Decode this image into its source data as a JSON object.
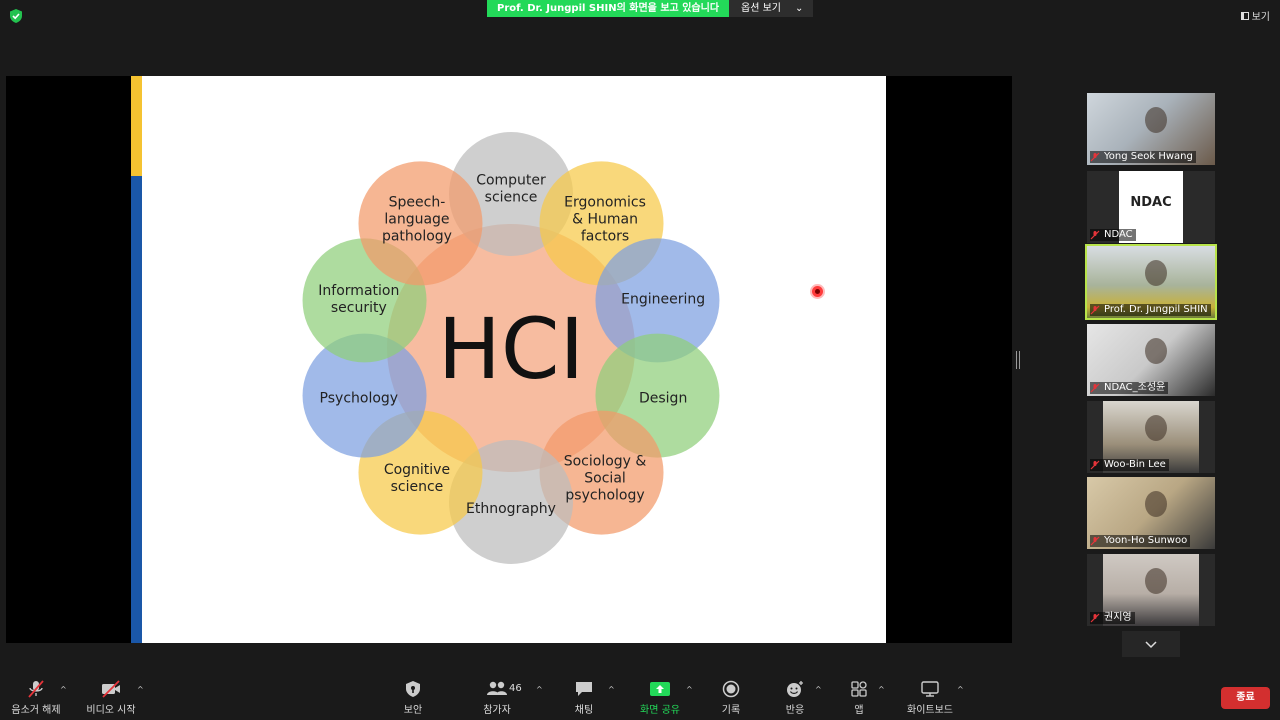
{
  "top": {
    "share_label": "Prof. Dr. Jungpil SHIN의 화면을 보고 있습니다",
    "options_label": "옵션 보기",
    "view_label": "보기"
  },
  "slide": {
    "center": "HCI",
    "petals": [
      {
        "lines": [
          "Computer",
          "science"
        ],
        "color": "#bdbdbd"
      },
      {
        "lines": [
          "Ergonomics",
          "& Human",
          "factors"
        ],
        "color": "#f7c948"
      },
      {
        "lines": [
          "Engineering"
        ],
        "color": "#7d9fe0"
      },
      {
        "lines": [
          "Design"
        ],
        "color": "#8fcf7a"
      },
      {
        "lines": [
          "Sociology &",
          "Social",
          "psychology"
        ],
        "color": "#f29a6a"
      },
      {
        "lines": [
          "Ethnography"
        ],
        "color": "#bdbdbd"
      },
      {
        "lines": [
          "Cognitive",
          "science"
        ],
        "color": "#f7c948"
      },
      {
        "lines": [
          "Psychology"
        ],
        "color": "#7d9fe0"
      },
      {
        "lines": [
          "Information",
          "security"
        ],
        "color": "#8fcf7a"
      },
      {
        "lines": [
          "Speech-",
          "language",
          "pathology"
        ],
        "color": "#f29a6a"
      }
    ]
  },
  "participants": [
    {
      "name": "Yong Seok Hwang"
    },
    {
      "name": "NDAC"
    },
    {
      "name": "Prof. Dr. Jungpil SHIN",
      "active": true
    },
    {
      "name": "NDAC_조성윤"
    },
    {
      "name": "Woo-Bin Lee"
    },
    {
      "name": "Yoon-Ho Sunwoo"
    },
    {
      "name": "권지영"
    }
  ],
  "ndac_logo": "NDAC",
  "toolbar": {
    "unmute": "음소거 해제",
    "start_video": "비디오 시작",
    "security": "보안",
    "participants": "참가자",
    "participant_count": "46",
    "chat": "채팅",
    "share_screen": "화면 공유",
    "record": "기록",
    "reactions": "반응",
    "apps": "앱",
    "whiteboard": "화이트보드",
    "end": "종료"
  }
}
